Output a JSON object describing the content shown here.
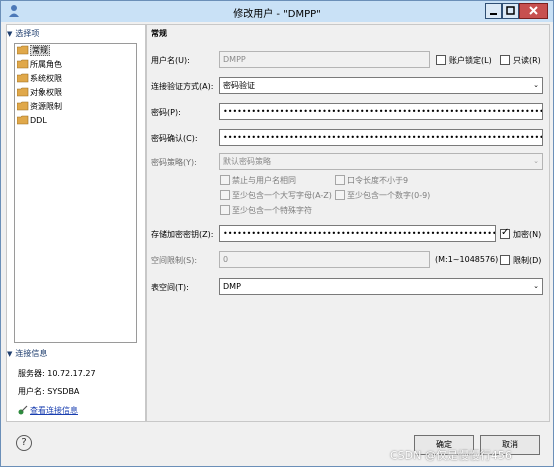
{
  "window": {
    "title": "修改用户 - \"DMPP\""
  },
  "left_panel": {
    "select_header": "选择项",
    "items": [
      "常规",
      "所属角色",
      "系统权限",
      "对象权限",
      "资源限制",
      "DDL"
    ],
    "conn_header": "连接信息",
    "server": "服务器: 10.72.17.27",
    "username": "用户名: SYSDBA",
    "view_link": "查看连接信息"
  },
  "form": {
    "section_title": "常规",
    "username_label": "用户名(U):",
    "username_value": "DMPP",
    "account_lock_label": "账户锁定(L)",
    "readonly_label": "只读(R)",
    "auth_label": "连接验证方式(A):",
    "auth_value": "密码验证",
    "password_label": "密码(P):",
    "password_value": "••••••••••••••••••••••••••••••••••••••••••••••••••••••••••••••••••••••••••••",
    "confirm_label": "密码确认(C):",
    "confirm_value": "••••••••••••••••••••••••••••••••••••••••••••••••••••••••••••••••••••••••••••",
    "policy_label": "密码策略(Y):",
    "policy_value": "默认密码策略",
    "policy_opts": [
      "禁止与用户名相同",
      "口令长度不小于9",
      "至少包含一个大写字母(A-Z)",
      "至少包含一个数字(0-9)",
      "至少包含一个特殊字符"
    ],
    "enc_key_label": "存储加密密钥(Z):",
    "enc_key_value": "••••••••••••••••••••••••••••••••••••••••••••••••••••••••••••••••••••",
    "encrypt_label": "加密(N)",
    "space_label": "空间限制(S):",
    "space_value": "0",
    "space_range": "(M:1~1048576)",
    "limit_label": "限制(D)",
    "tablespace_label": "表空间(T):",
    "tablespace_value": "DMP"
  },
  "buttons": {
    "ok": "确定",
    "cancel": "取消",
    "help": "?"
  },
  "watermark": "CSDN @仅是慢慢行456",
  "colors": {
    "titlebar": "#c9e1f6",
    "close": "#c75050",
    "link": "#1a3fb0"
  }
}
